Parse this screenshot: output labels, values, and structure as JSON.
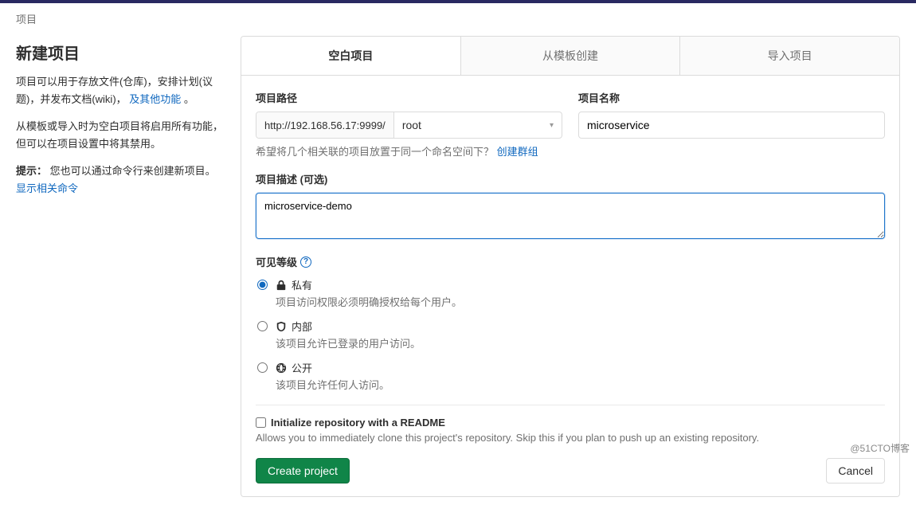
{
  "breadcrumb": "项目",
  "sidebar": {
    "title": "新建项目",
    "para1_a": "项目可以用于存放文件(仓库)，安排计划(议题)，并发布文档(wiki)，",
    "para1_link": "及其他功能",
    "para1_b": "。",
    "para2": "从模板或导入时为空白项目将启用所有功能，但可以在项目设置中将其禁用。",
    "tip_label": "提示：",
    "tip_text": "您也可以通过命令行来创建新项目。",
    "tip_link": "显示相关命令"
  },
  "tabs": {
    "blank": "空白项目",
    "template": "从模板创建",
    "import": "导入项目"
  },
  "form": {
    "path_label": "项目路径",
    "path_url": "http://192.168.56.17:9999/",
    "namespace": "root",
    "name_label": "项目名称",
    "name_value": "microservice",
    "path_hint_text": "希望将几个相关联的项目放置于同一个命名空间下？",
    "path_hint_link": "创建群组",
    "desc_label": "项目描述 (可选)",
    "desc_value": "microservice-demo",
    "vis_label": "可见等级",
    "vis_private_label": "私有",
    "vis_private_desc": "项目访问权限必须明确授权给每个用户。",
    "vis_internal_label": "内部",
    "vis_internal_desc": "该项目允许已登录的用户访问。",
    "vis_public_label": "公开",
    "vis_public_desc": "该项目允许任何人访问。",
    "readme_label": "Initialize repository with a README",
    "readme_desc": "Allows you to immediately clone this project's repository. Skip this if you plan to push up an existing repository.",
    "create_btn": "Create project",
    "cancel_btn": "Cancel"
  },
  "watermark": "@51CTO博客"
}
